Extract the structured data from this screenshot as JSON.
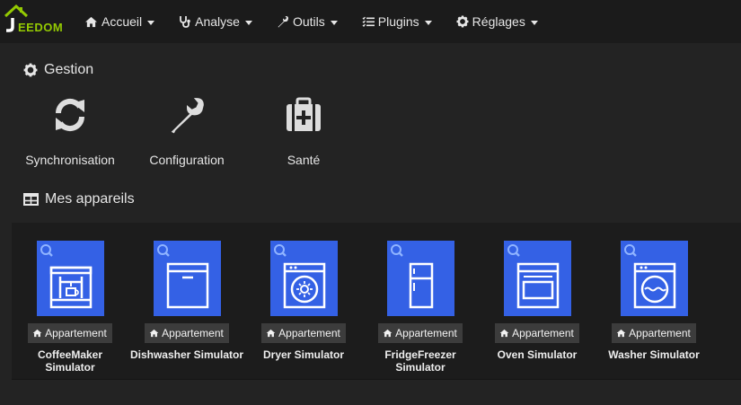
{
  "brand": {
    "logo_text": "EEDOM",
    "accent": "#94ca02"
  },
  "nav": {
    "items": [
      {
        "label": "Accueil",
        "icon": "home-icon"
      },
      {
        "label": "Analyse",
        "icon": "stethoscope-icon"
      },
      {
        "label": "Outils",
        "icon": "wrench-icon"
      },
      {
        "label": "Plugins",
        "icon": "list-icon"
      },
      {
        "label": "Réglages",
        "icon": "cog-icon"
      }
    ]
  },
  "gestion": {
    "title": "Gestion",
    "items": [
      {
        "label": "Synchronisation",
        "icon": "sync-icon"
      },
      {
        "label": "Configuration",
        "icon": "wrench-icon"
      },
      {
        "label": "Santé",
        "icon": "medical-kit-icon"
      }
    ]
  },
  "appareils": {
    "title": "Mes appareils",
    "tile_color": "#3461e5",
    "devices": [
      {
        "name": "CoffeeMaker Simulator",
        "room": "Appartement",
        "icon": "coffee-maker-icon"
      },
      {
        "name": "Dishwasher Simulator",
        "room": "Appartement",
        "icon": "dishwasher-icon"
      },
      {
        "name": "Dryer Simulator",
        "room": "Appartement",
        "icon": "dryer-icon"
      },
      {
        "name": "FridgeFreezer Simulator",
        "room": "Appartement",
        "icon": "fridge-icon"
      },
      {
        "name": "Oven Simulator",
        "room": "Appartement",
        "icon": "oven-icon"
      },
      {
        "name": "Washer Simulator",
        "room": "Appartement",
        "icon": "washer-icon"
      }
    ]
  }
}
